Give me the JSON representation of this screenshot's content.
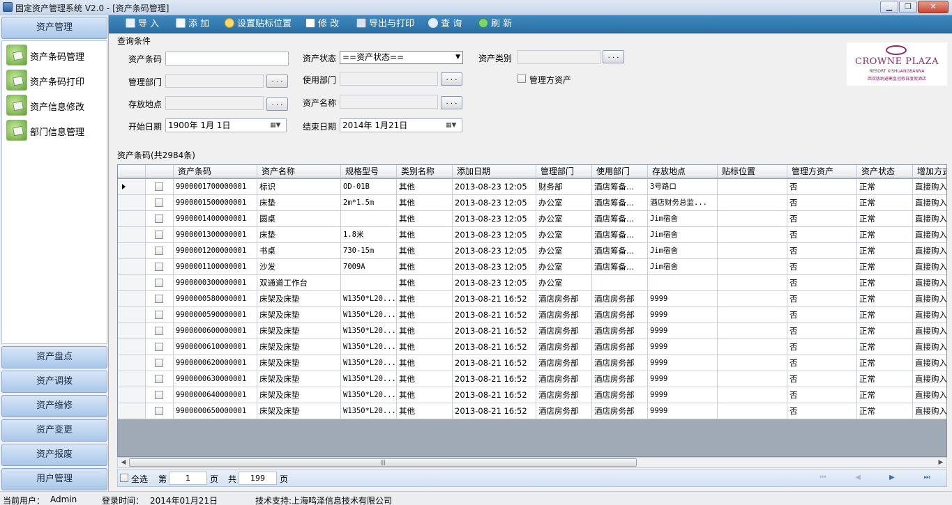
{
  "window": {
    "title": "固定资产管理系统 V2.0 - [资产条码管理]"
  },
  "nav": {
    "top_group": "资产管理",
    "items": [
      "资产条码管理",
      "资产条码打印",
      "资产信息修改",
      "部门信息管理"
    ],
    "groups": [
      "资产盘点",
      "资产调拨",
      "资产维修",
      "资产变更",
      "资产报废",
      "用户管理"
    ]
  },
  "toolbar": [
    "导 入",
    "添 加",
    "设置贴标位置",
    "修 改",
    "导出与打印",
    "查 询",
    "刷 新"
  ],
  "query": {
    "section_title": "查询条件",
    "asset_code_label": "资产条码",
    "asset_code_value": "",
    "status_label": "资产状态",
    "status_value": "==资产状态==",
    "category_label": "资产类别",
    "mgmt_dept_label": "管理部门",
    "use_dept_label": "使用部门",
    "mgmt_asset_label": "管理方资产",
    "location_label": "存放地点",
    "asset_name_label": "资产名称",
    "start_date_label": "开始日期",
    "start_date_value": "1900年  1月  1日",
    "end_date_label": "结束日期",
    "end_date_value": "2014年  1月21日",
    "ellipsis": ". . ."
  },
  "logo": {
    "brand": "CROWNE PLAZA",
    "sub1": "RESORT XISHUANGBANNA",
    "sub2": "西双版纳避寒皇冠假日度假酒店"
  },
  "grid": {
    "title": "资产条码(共2984条)",
    "columns": [
      "资产条码",
      "资产名称",
      "规格型号",
      "类别名称",
      "添加日期",
      "管理部门",
      "使用部门",
      "存放地点",
      "贴标位置",
      "管理方资产",
      "资产状态",
      "增加方式"
    ],
    "rows": [
      [
        "9900001700000001",
        "标识",
        "OD-01B",
        "其他",
        "2013-08-23 12:05",
        "财务部",
        "酒店筹备...",
        "3号路口",
        "",
        "否",
        "正常",
        "直接购入"
      ],
      [
        "9900001500000001",
        "床垫",
        "2m*1.5m",
        "其他",
        "2013-08-23 12:05",
        "办公室",
        "酒店筹备...",
        "酒店财务总监...",
        "",
        "否",
        "正常",
        "直接购入"
      ],
      [
        "9900001400000001",
        "圆桌",
        "",
        "其他",
        "2013-08-23 12:05",
        "办公室",
        "酒店筹备...",
        "Jim宿舍",
        "",
        "否",
        "正常",
        "直接购入"
      ],
      [
        "9900001300000001",
        "床垫",
        "1.8米",
        "其他",
        "2013-08-23 12:05",
        "办公室",
        "酒店筹备...",
        "Jim宿舍",
        "",
        "否",
        "正常",
        "直接购入"
      ],
      [
        "9900001200000001",
        "书桌",
        "730-15m",
        "其他",
        "2013-08-23 12:05",
        "办公室",
        "酒店筹备...",
        "Jim宿舍",
        "",
        "否",
        "正常",
        "直接购入"
      ],
      [
        "9900001100000001",
        "沙发",
        "7009A",
        "其他",
        "2013-08-23 12:05",
        "办公室",
        "酒店筹备...",
        "Jim宿舍",
        "",
        "否",
        "正常",
        "直接购入"
      ],
      [
        "9900000300000001",
        "双通道工作台",
        "",
        "其他",
        "2013-08-23 12:05",
        "办公室",
        "",
        "",
        "",
        "否",
        "正常",
        "直接购入"
      ],
      [
        "9900000580000001",
        "床架及床垫",
        "W1350*L20...",
        "其他",
        "2013-08-21 16:52",
        "酒店房务部",
        "酒店房务部",
        "9999",
        "",
        "否",
        "正常",
        "直接购入"
      ],
      [
        "9900000590000001",
        "床架及床垫",
        "W1350*L20...",
        "其他",
        "2013-08-21 16:52",
        "酒店房务部",
        "酒店房务部",
        "9999",
        "",
        "否",
        "正常",
        "直接购入"
      ],
      [
        "9900000600000001",
        "床架及床垫",
        "W1350*L20...",
        "其他",
        "2013-08-21 16:52",
        "酒店房务部",
        "酒店房务部",
        "9999",
        "",
        "否",
        "正常",
        "直接购入"
      ],
      [
        "9900000610000001",
        "床架及床垫",
        "W1350*L20...",
        "其他",
        "2013-08-21 16:52",
        "酒店房务部",
        "酒店房务部",
        "9999",
        "",
        "否",
        "正常",
        "直接购入"
      ],
      [
        "9900000620000001",
        "床架及床垫",
        "W1350*L20...",
        "其他",
        "2013-08-21 16:52",
        "酒店房务部",
        "酒店房务部",
        "9999",
        "",
        "否",
        "正常",
        "直接购入"
      ],
      [
        "9900000630000001",
        "床架及床垫",
        "W1350*L20...",
        "其他",
        "2013-08-21 16:52",
        "酒店房务部",
        "酒店房务部",
        "9999",
        "",
        "否",
        "正常",
        "直接购入"
      ],
      [
        "9900000640000001",
        "床架及床垫",
        "W1350*L20...",
        "其他",
        "2013-08-21 16:52",
        "酒店房务部",
        "酒店房务部",
        "9999",
        "",
        "否",
        "正常",
        "直接购入"
      ],
      [
        "9900000650000001",
        "床架及床垫",
        "W1350*L20...",
        "其他",
        "2013-08-21 16:52",
        "酒店房务部",
        "酒店房务部",
        "9999",
        "",
        "否",
        "正常",
        "直接购入"
      ]
    ]
  },
  "pager": {
    "select_all": "全选",
    "page_prefix": "第",
    "page_value": "1",
    "page_suffix": "页",
    "total_prefix": "共",
    "total_value": "199",
    "total_suffix": "页"
  },
  "status": {
    "user_label": "当前用户：",
    "user_value": "Admin",
    "login_label": "登录时间：",
    "login_value": "2014年01月21日",
    "support": "技术支持:上海鸣泽信息技术有限公司"
  }
}
